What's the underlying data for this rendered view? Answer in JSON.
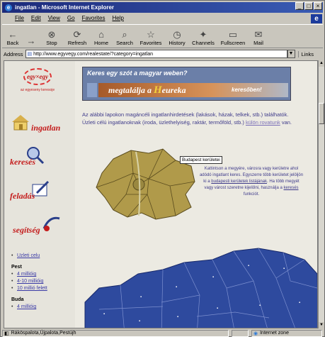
{
  "window": {
    "title": "ingatlan - Microsoft Internet Explorer",
    "controls": [
      "_",
      "□",
      "×"
    ]
  },
  "menu": [
    "File",
    "Edit",
    "View",
    "Go",
    "Favorites",
    "Help"
  ],
  "toolbar": [
    {
      "label": "Back",
      "icon": "back-arrow-icon",
      "glyph": "←"
    },
    {
      "label": "",
      "icon": "forward-arrow-icon",
      "glyph": "→"
    },
    {
      "label": "Stop",
      "icon": "stop-icon",
      "glyph": "⊗"
    },
    {
      "label": "Refresh",
      "icon": "refresh-icon",
      "glyph": "⟳"
    },
    {
      "label": "Home",
      "icon": "home-icon",
      "glyph": "⌂"
    },
    {
      "label": "Search",
      "icon": "search-icon",
      "glyph": "⌕"
    },
    {
      "label": "Favorites",
      "icon": "favorites-icon",
      "glyph": "☆"
    },
    {
      "label": "History",
      "icon": "history-icon",
      "glyph": "◷"
    },
    {
      "label": "Channels",
      "icon": "channels-icon",
      "glyph": "✦"
    },
    {
      "label": "Fullscreen",
      "icon": "fullscreen-icon",
      "glyph": "▭"
    },
    {
      "label": "Mail",
      "icon": "mail-icon",
      "glyph": "✉"
    }
  ],
  "address": {
    "label": "Address",
    "value": "http://www.egyvegy.com/realestate/?category=ingatlan",
    "links": "Links"
  },
  "sidebar": {
    "logo_text": "egy×egy",
    "logo_sub": "az egyeseny keresoje",
    "nav": [
      {
        "label": "ingatlan",
        "icon": "house-icon"
      },
      {
        "label": "keresés",
        "icon": "search-magnifier-icon"
      },
      {
        "label": "feladás",
        "icon": "pen-icon"
      },
      {
        "label": "segítség",
        "icon": "help-icon"
      }
    ],
    "links": [
      {
        "type": "item",
        "text": "Uzleti celu"
      },
      {
        "type": "head",
        "text": "Pest"
      },
      {
        "type": "item",
        "text": "4 millióig"
      },
      {
        "type": "item",
        "text": "4-10 millióig"
      },
      {
        "type": "item",
        "text": "10 millió felett"
      },
      {
        "type": "head",
        "text": "Buda"
      },
      {
        "type": "item",
        "text": "4 millióig"
      }
    ]
  },
  "banner": {
    "top": "Keres egy szót a magyar weben?",
    "main_prefix": "megtalálja a ",
    "main_brand": "H",
    "main_rest": "eureka",
    "suffix": "keresőben!"
  },
  "intro": {
    "text": "Az alábbi lapokon magáncéli ingatlanhirdetések (lakások, házak, telkek, stb.) találhatók. Üzleti célú ingatlanoknak (iroda, üzlethelyiség, raktár, termőföld, stb.)",
    "link": "külön rovatunk",
    "tail": " van."
  },
  "map": {
    "budapest_button": "Budapest kerületei",
    "desc": "Kattintson a megyére, városra vagy kerületre ahol adódó ingatlant keres. Egyszerre több kerületet jelöljön ki a",
    "desc_link": "budapesti kerületek listájának",
    "desc2": ". Ha több megyét vagy várost szeretne kijelölni, használja a",
    "desc_link2": "keresés",
    "desc3": " funkciót."
  },
  "status": {
    "text": "Ráköspalota,Újpalota,Pestújh",
    "zone": "Internet zone"
  },
  "colors": {
    "title": "#1c2a7a",
    "map_budapest": "#b09a4a",
    "map_country": "#2e4a9e",
    "text": "#3e3a8a",
    "nav": "#c41c1c"
  }
}
